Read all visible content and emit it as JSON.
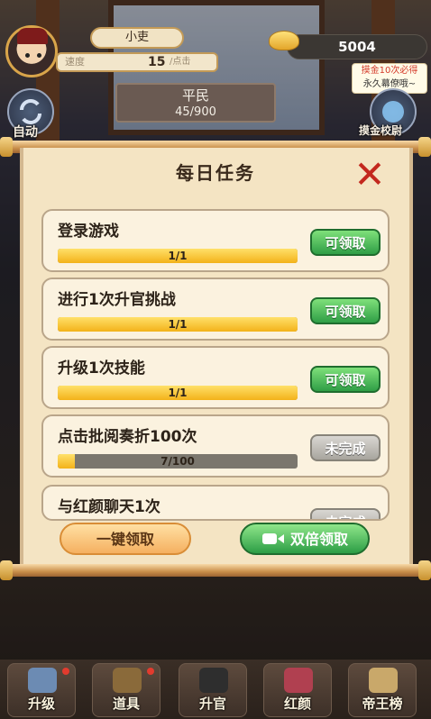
{
  "hud": {
    "player_name": "小吏",
    "speed_label": "速度",
    "speed_value": "15",
    "speed_unit": "/点击",
    "coins": "5004",
    "promo_line1": "摸金10次必得",
    "promo_line2": "永久幕僚哦~",
    "rank_title": "平民",
    "rank_progress": "45/900",
    "left_button_label": "自动",
    "right_button_label": "摸金校尉"
  },
  "panel": {
    "title": "每日任务",
    "tasks": [
      {
        "name": "登录游戏",
        "progress_text": "1/1",
        "progress": 1.0,
        "button": "可领取",
        "state": "claim"
      },
      {
        "name": "进行1次升官挑战",
        "progress_text": "1/1",
        "progress": 1.0,
        "button": "可领取",
        "state": "claim"
      },
      {
        "name": "升级1次技能",
        "progress_text": "1/1",
        "progress": 1.0,
        "button": "可领取",
        "state": "claim"
      },
      {
        "name": "点击批阅奏折100次",
        "progress_text": "7/100",
        "progress": 0.07,
        "button": "未完成",
        "state": "todo"
      },
      {
        "name": "与红颜聊天1次",
        "progress_text": "",
        "progress": 0,
        "button": "未完成",
        "state": "todo"
      }
    ],
    "claim_all_label": "一键领取",
    "double_claim_label": "双倍领取"
  },
  "bottom_nav": [
    {
      "label": "升级",
      "icon": "upgrade-icon"
    },
    {
      "label": "道具",
      "icon": "chest-icon"
    },
    {
      "label": "升官",
      "icon": "official-hat-icon"
    },
    {
      "label": "红颜",
      "icon": "lady-icon"
    },
    {
      "label": "帝王榜",
      "icon": "scroll-icon"
    }
  ],
  "colors": {
    "claim_green": "#2f9e46",
    "todo_gray": "#a8a59e",
    "progress_fill": "#f3b21a",
    "close_red": "#c3281e",
    "paper": "#f4e4c3"
  }
}
